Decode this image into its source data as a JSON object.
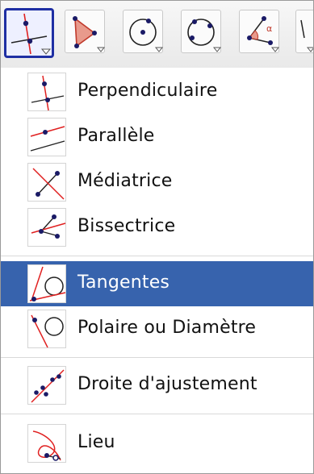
{
  "toolbar": {
    "tools": [
      {
        "icon": "perpendicular-line-icon",
        "active": true
      },
      {
        "icon": "polygon-icon",
        "active": false
      },
      {
        "icon": "circle-center-point-icon",
        "active": false
      },
      {
        "icon": "circle-three-points-icon",
        "active": false
      },
      {
        "icon": "angle-icon",
        "active": false
      },
      {
        "icon": "overflow-tool-icon",
        "active": false
      }
    ],
    "angle_symbol": "α"
  },
  "menu": {
    "items": [
      {
        "label": "Perpendiculaire",
        "icon": "perpendicular-line-icon"
      },
      {
        "label": "Parallèle",
        "icon": "parallel-line-icon"
      },
      {
        "label": "Médiatrice",
        "icon": "perpendicular-bisector-icon"
      },
      {
        "label": "Bissectrice",
        "icon": "angle-bisector-icon"
      },
      {
        "label": "Tangentes",
        "icon": "tangents-icon",
        "selected": true
      },
      {
        "label": "Polaire ou Diamètre",
        "icon": "polar-diameter-icon"
      },
      {
        "label": "Droite d'ajustement",
        "icon": "best-fit-line-icon"
      },
      {
        "label": "Lieu",
        "icon": "locus-icon"
      }
    ]
  },
  "colors": {
    "selection": "#3763ad",
    "active_tool_border": "#1f2fa3",
    "line_red": "#e02020",
    "point_blue": "#1a1a66"
  }
}
